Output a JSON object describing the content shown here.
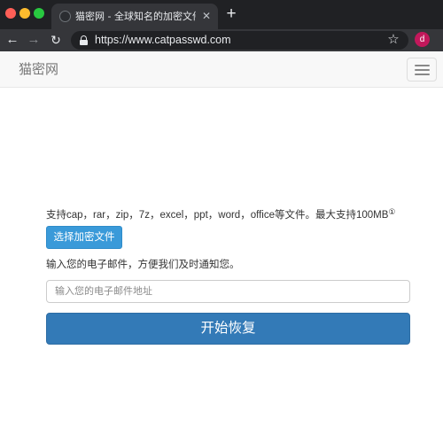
{
  "browser": {
    "tab": {
      "title": "猫密网 - 全球知名的加密文件恢",
      "close_glyph": "✕"
    },
    "new_tab_glyph": "+",
    "nav": {
      "back_glyph": "←",
      "forward_glyph": "→",
      "reload_glyph": "↻"
    },
    "address_bar": {
      "url": "https://www.catpasswd.com"
    },
    "bookmark_glyph": "☆",
    "profile_initial": "d",
    "profile_color": "#c2185b"
  },
  "site": {
    "brand": "猫密网",
    "menu_icon": "hamburger-menu-icon"
  },
  "main": {
    "support_text": "支持cap，rar，zip，7z，excel，ppt，word，office等文件。最大支持100MB",
    "support_note_marker": "①",
    "choose_file_button": "选择加密文件",
    "email_prompt": "输入您的电子邮件，方便我们及时通知您。",
    "email_input": {
      "value": "",
      "placeholder": "输入您的电子邮件地址"
    },
    "start_button": "开始恢复"
  },
  "colors": {
    "choose_button": "#3a9ad9",
    "start_button": "#337ab7",
    "tabstrip": "#202124",
    "toolbar": "#35363a"
  }
}
